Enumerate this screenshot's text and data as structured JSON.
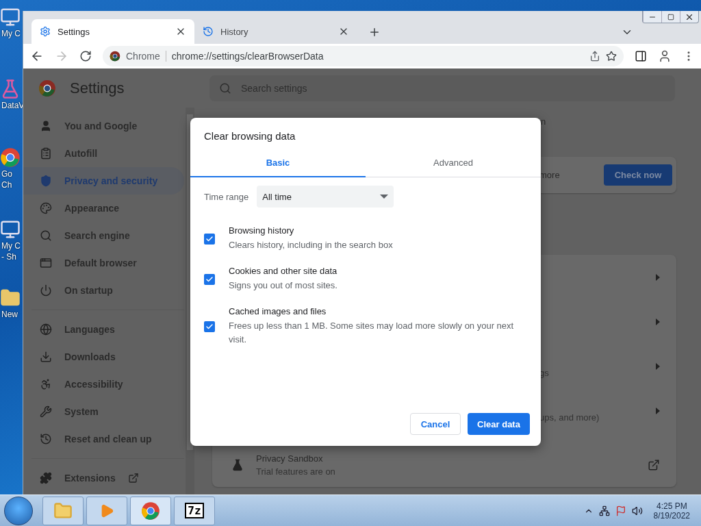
{
  "desktop": {
    "icons": [
      {
        "kind": "computer",
        "lines": [
          "My C"
        ]
      },
      {
        "kind": "data",
        "lines": [
          "DataV"
        ]
      },
      {
        "kind": "chrome",
        "lines": [
          "Go",
          "Ch"
        ]
      },
      {
        "kind": "computer",
        "lines": [
          "My C",
          "- Sh"
        ]
      },
      {
        "kind": "folder",
        "lines": [
          "New"
        ]
      }
    ]
  },
  "tabs": [
    {
      "title": "Settings",
      "selected": true
    },
    {
      "title": "History",
      "selected": false
    }
  ],
  "address": {
    "site_label": "Chrome",
    "url": "chrome://settings/clearBrowserData"
  },
  "header": {
    "title": "Settings",
    "search_placeholder": "Search settings"
  },
  "sidebar": {
    "groups": [
      [
        {
          "label": "You and Google",
          "selected": false
        },
        {
          "label": "Autofill",
          "selected": false
        },
        {
          "label": "Privacy and security",
          "selected": true
        },
        {
          "label": "Appearance",
          "selected": false
        },
        {
          "label": "Search engine",
          "selected": false
        },
        {
          "label": "Default browser",
          "selected": false
        },
        {
          "label": "On startup",
          "selected": false
        }
      ],
      [
        {
          "label": "Languages",
          "selected": false
        },
        {
          "label": "Downloads",
          "selected": false
        },
        {
          "label": "Accessibility",
          "selected": false
        },
        {
          "label": "System",
          "selected": false
        },
        {
          "label": "Reset and clean up",
          "selected": false
        }
      ],
      [
        {
          "label": "Extensions",
          "selected": false
        }
      ]
    ]
  },
  "background_page": {
    "top_fragment": "n",
    "safety_fragment": "more",
    "check_button": "Check now",
    "rows": [
      {
        "kind": "arrow"
      },
      {
        "kind": "arrow"
      },
      {
        "kind": "arrow",
        "text": "gs"
      },
      {
        "kind": "arrow",
        "text": "ups, and more)"
      },
      {
        "kind": "external",
        "title": "Privacy Sandbox",
        "subtitle": "Trial features are on"
      }
    ]
  },
  "dialog": {
    "title": "Clear browsing data",
    "tabs": [
      {
        "label": "Basic",
        "selected": true
      },
      {
        "label": "Advanced",
        "selected": false
      }
    ],
    "time_range": {
      "label": "Time range",
      "value": "All time"
    },
    "options": [
      {
        "title": "Browsing history",
        "description": "Clears history, including in the search box",
        "checked": true
      },
      {
        "title": "Cookies and other site data",
        "description": "Signs you out of most sites.",
        "checked": true
      },
      {
        "title": "Cached images and files",
        "description": "Frees up less than 1 MB. Some sites may load more slowly on your next visit.",
        "checked": true
      }
    ],
    "cancel": "Cancel",
    "confirm": "Clear data"
  },
  "taskbar": {
    "apps": [
      {
        "kind": "explorer"
      },
      {
        "kind": "media"
      },
      {
        "kind": "chrome"
      },
      {
        "kind": "archiver",
        "label": "7z"
      }
    ],
    "time": "4:25 PM",
    "date": "8/19/2022"
  }
}
